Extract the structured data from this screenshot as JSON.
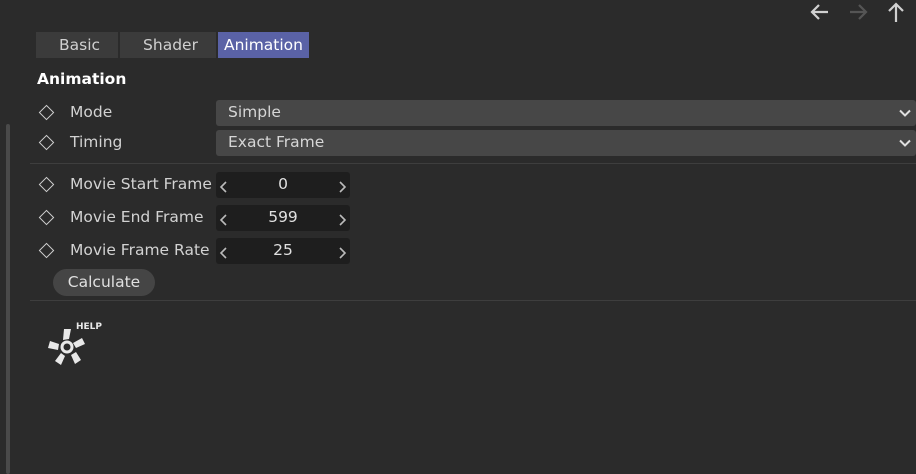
{
  "tabs": [
    {
      "label": "Basic",
      "active": false
    },
    {
      "label": "Shader",
      "active": false
    },
    {
      "label": "Animation",
      "active": true
    }
  ],
  "section": {
    "title": "Animation"
  },
  "fields": {
    "mode": {
      "label": "Mode",
      "value": "Simple"
    },
    "timing": {
      "label": "Timing",
      "value": "Exact Frame"
    },
    "start": {
      "label": "Movie Start Frame",
      "value": "0"
    },
    "end": {
      "label": "Movie End Frame",
      "value": "599"
    },
    "rate": {
      "label": "Movie Frame Rate",
      "value": "25"
    }
  },
  "calculate_label": "Calculate",
  "help": {
    "label": "HELP"
  },
  "colors": {
    "accent": "#5a62a6",
    "background": "#2b2b2b"
  },
  "icons": [
    "back-arrow-icon",
    "forward-arrow-icon",
    "up-arrow-icon",
    "keyframe-diamond-icon",
    "chevron-down-icon",
    "chevron-left-icon",
    "chevron-right-icon",
    "help-logo-icon"
  ]
}
